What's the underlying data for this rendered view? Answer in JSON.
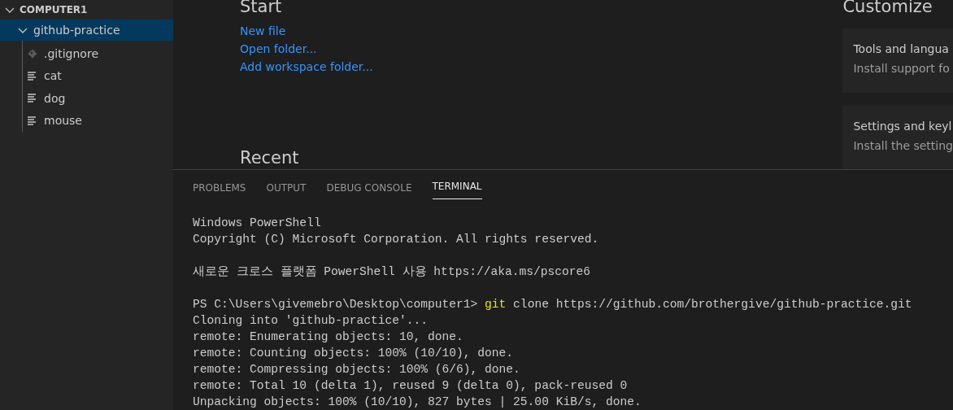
{
  "explorer": {
    "title": "COMPUTER1",
    "expanded": true,
    "items": [
      {
        "label": "github-practice",
        "expanded": true,
        "selected": true,
        "children": [
          {
            "label": ".gitignore",
            "kind": "git",
            "selected": false
          },
          {
            "label": "cat",
            "kind": "text",
            "selected": false
          },
          {
            "label": "dog",
            "kind": "text",
            "selected": false
          },
          {
            "label": "mouse",
            "kind": "text",
            "selected": false
          }
        ]
      }
    ]
  },
  "welcome": {
    "start": {
      "title": "Start",
      "links": [
        "New file",
        "Open folder...",
        "Add workspace folder..."
      ]
    },
    "recent": {
      "title": "Recent"
    },
    "customize": {
      "title": "Customize",
      "cards": [
        {
          "title": "Tools and langua",
          "description": "Install support fo"
        },
        {
          "title": "Settings and keyl",
          "description": "Install the setting"
        }
      ]
    }
  },
  "panel": {
    "tabs": [
      {
        "label": "PROBLEMS",
        "selected": false
      },
      {
        "label": "OUTPUT",
        "selected": false
      },
      {
        "label": "DEBUG CONSOLE",
        "selected": false
      },
      {
        "label": "TERMINAL",
        "selected": true
      }
    ],
    "terminal": [
      [
        {
          "text": "Windows PowerShell"
        },
        {
          "text": "Copyright (C) Microsoft Corporation. All rights reserved."
        }
      ],
      [
        {
          "text": "새로운 크로스 플랫폼 PowerShell 사용 https://aka.ms/pscore6"
        }
      ],
      [
        {
          "prompt": "PS C:\\Users\\givemebro\\Desktop\\computer1> ",
          "command": "git",
          "text": " clone https://github.com/brothergive/github-practice.git"
        },
        {
          "text": "Cloning into 'github-practice'..."
        },
        {
          "text": "remote: Enumerating objects: 10, done."
        },
        {
          "text": "remote: Counting objects: 100% (10/10), done."
        },
        {
          "text": "remote: Compressing objects: 100% (6/6), done."
        },
        {
          "text": "remote: Total 10 (delta 1), reused 9 (delta 0), pack-reused 0"
        },
        {
          "text": "Unpacking objects: 100% (10/10), 827 bytes | 25.00 KiB/s, done."
        }
      ]
    ]
  }
}
